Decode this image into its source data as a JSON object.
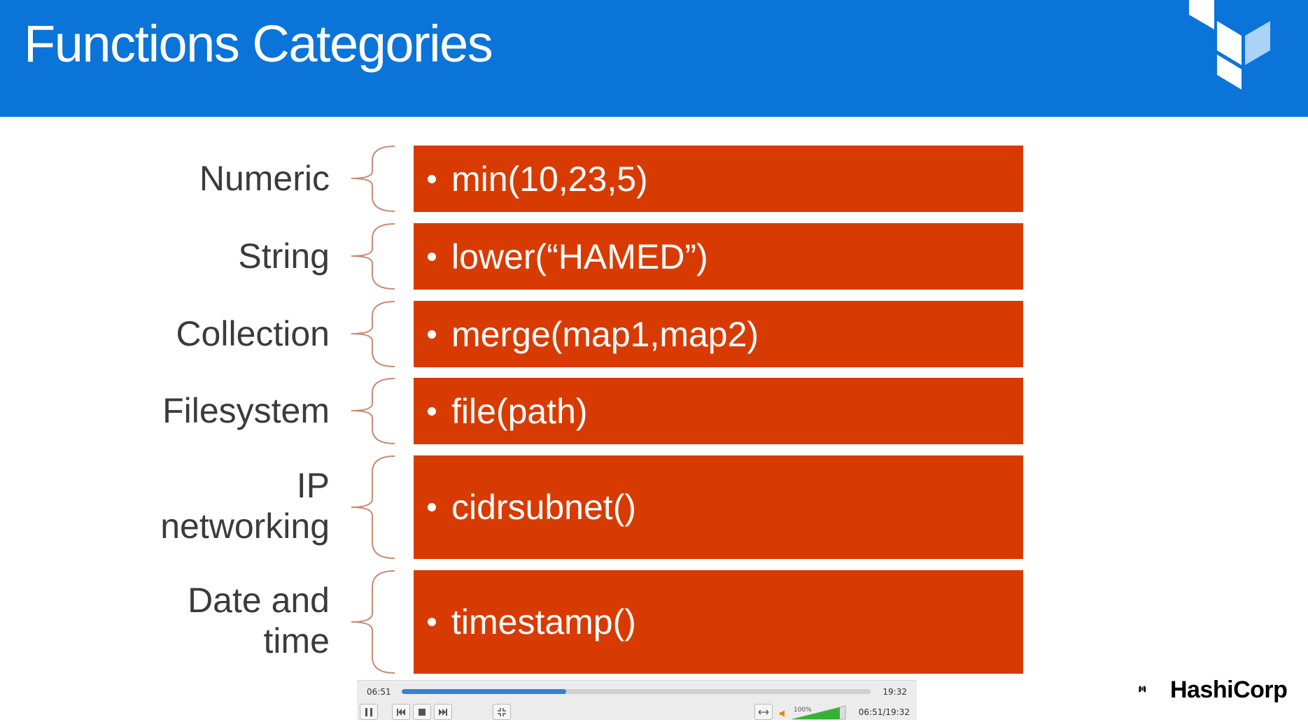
{
  "slide": {
    "title": "Functions Categories",
    "categories": [
      {
        "label": "Numeric",
        "function": "min(10,23,5)"
      },
      {
        "label": "String",
        "function": "lower(“HAMED”)"
      },
      {
        "label": "Collection",
        "function": "merge(map1,map2)"
      },
      {
        "label": "Filesystem",
        "function": "file(path)"
      },
      {
        "label": "IP networking",
        "label_lines": [
          "IP",
          "networking"
        ],
        "function": "cidrsubnet()"
      },
      {
        "label": "Date and time",
        "label_lines": [
          "Date and",
          "time"
        ],
        "function": "timestamp()"
      }
    ]
  },
  "player": {
    "current_time": "06:51",
    "total_time": "19:32",
    "progress": 0.351,
    "volume": "100%",
    "elapsed_display": "06:51/19:32"
  },
  "branding": {
    "hashicorp": "HashiCorp"
  },
  "colors": {
    "header": "#0b74d8",
    "box": "#d83b01",
    "brace": "#c98a72",
    "logo_dark": "#ffffff",
    "logo_light": "#a9d4f7"
  }
}
